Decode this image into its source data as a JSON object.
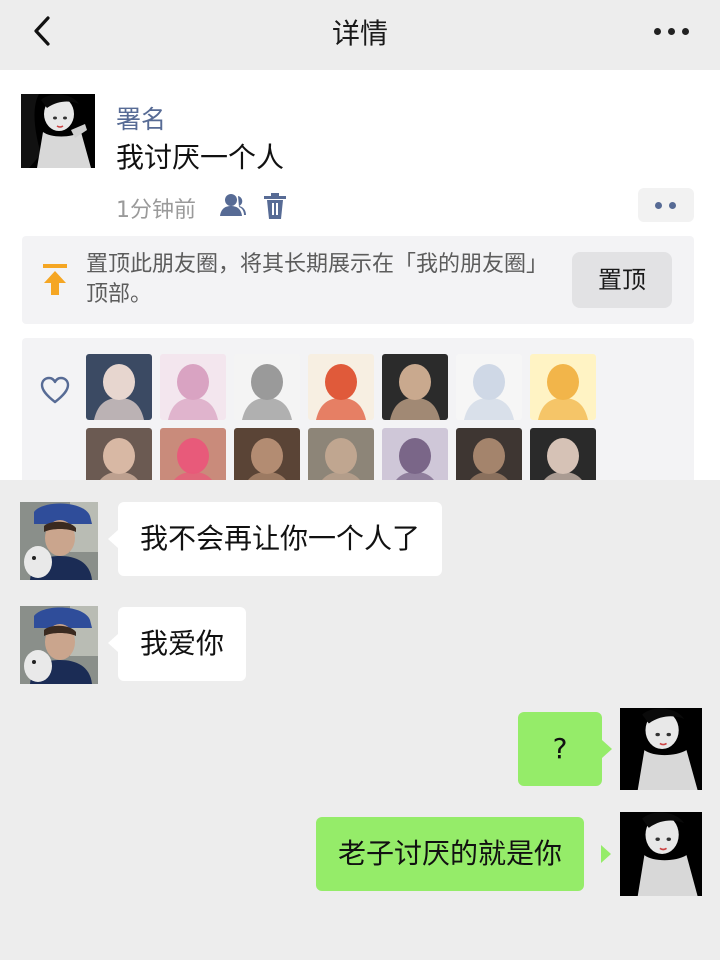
{
  "nav": {
    "title": "详情"
  },
  "post": {
    "author": "署名",
    "content": "我讨厌一个人",
    "time": "1分钟前",
    "pin_prompt": "置顶此朋友圈，将其长期展示在「我的朋友圈」顶部。",
    "pin_button": "置顶"
  },
  "likes": {
    "count": 14
  },
  "chat": {
    "messages": [
      {
        "side": "left",
        "text": "我不会再让你一个人了"
      },
      {
        "side": "left",
        "text": "我爱你"
      },
      {
        "side": "right",
        "text": "?"
      },
      {
        "side": "right",
        "text": "老子讨厌的就是你"
      }
    ]
  },
  "colors": {
    "link_blue": "#576b95",
    "bubble_green": "#95ec69",
    "pin_orange": "#f5a623"
  },
  "icons": {
    "back": "back-chevron-icon",
    "more": "more-dots-icon",
    "privacy": "people-icon",
    "delete": "trash-icon",
    "pin": "pin-top-icon",
    "like": "heart-icon"
  }
}
